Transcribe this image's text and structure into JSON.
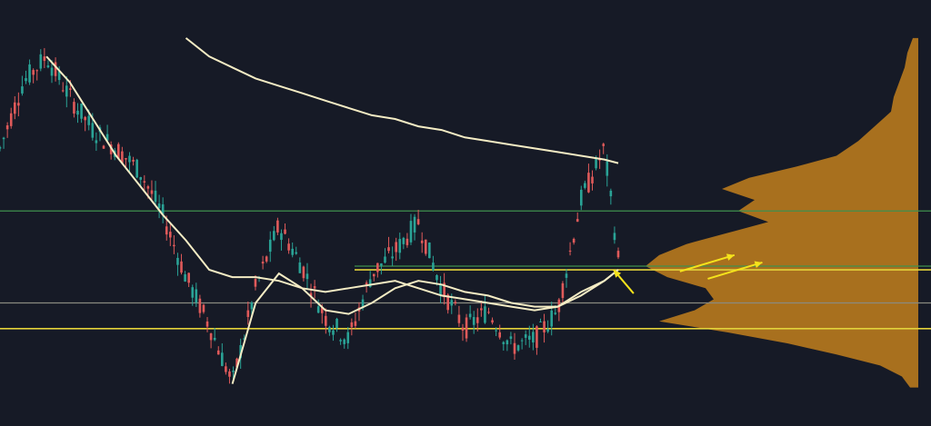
{
  "colors": {
    "background": "#161a26",
    "candle_up": "#2aa396",
    "candle_down": "#e05a5a",
    "moving_average": "#f4ecc4",
    "volume_profile": "#b87a1e",
    "level_green": "#3f8f4e",
    "level_yellow": "#e3d23a",
    "level_gray": "#8a8a80",
    "arrow": "#f5e31b"
  },
  "chart_data": {
    "type": "line",
    "title": "",
    "xlabel": "",
    "ylabel": "",
    "grid": false,
    "legend": "none",
    "ylim": [
      0,
      100
    ],
    "x": [
      0,
      5,
      10,
      15,
      20,
      25,
      30,
      35,
      40,
      45,
      50,
      55,
      60,
      65,
      70,
      75,
      80,
      85,
      90,
      95,
      100,
      105,
      110,
      115,
      120,
      125,
      130,
      133
    ],
    "series": [
      {
        "values": [
          72,
          90,
          97,
          86,
          77,
          72,
          66,
          54,
          37,
          24,
          8,
          34,
          51,
          40,
          26,
          20,
          38,
          44,
          52,
          34,
          23,
          28,
          18,
          20,
          28,
          58,
          72,
          42
        ]
      },
      {
        "values": [
          null,
          null,
          97,
          90,
          80,
          70,
          62,
          54,
          47,
          39,
          37,
          37,
          36,
          34,
          33,
          34,
          35,
          36,
          34,
          32,
          31,
          30,
          29,
          28,
          29,
          32,
          36,
          39
        ]
      },
      {
        "values": [
          null,
          null,
          null,
          null,
          null,
          null,
          null,
          null,
          null,
          null,
          8,
          30,
          38,
          34,
          28,
          27,
          30,
          34,
          36,
          35,
          33,
          32,
          30,
          29,
          29,
          33,
          36,
          39
        ]
      },
      {
        "values": [
          null,
          null,
          null,
          null,
          null,
          null,
          null,
          null,
          102,
          97,
          94,
          91,
          89,
          87,
          85,
          83,
          81,
          80,
          78,
          77,
          75,
          74,
          73,
          72,
          71,
          70,
          69,
          68
        ]
      }
    ],
    "levels": [
      {
        "value": 55,
        "color": "green"
      },
      {
        "value": 40,
        "color": "green"
      },
      {
        "value": 39,
        "color": "yellow"
      },
      {
        "value": 30,
        "color": "gray"
      },
      {
        "value": 23,
        "color": "yellow"
      }
    ],
    "volume_profile": {
      "anchor_side": "right",
      "values": [
        {
          "price": 102,
          "vol": 0.02
        },
        {
          "price": 98,
          "vol": 0.04
        },
        {
          "price": 94,
          "vol": 0.05
        },
        {
          "price": 90,
          "vol": 0.07
        },
        {
          "price": 86,
          "vol": 0.09
        },
        {
          "price": 82,
          "vol": 0.1
        },
        {
          "price": 78,
          "vol": 0.16
        },
        {
          "price": 74,
          "vol": 0.22
        },
        {
          "price": 70,
          "vol": 0.3
        },
        {
          "price": 67,
          "vol": 0.45
        },
        {
          "price": 64,
          "vol": 0.62
        },
        {
          "price": 61,
          "vol": 0.72
        },
        {
          "price": 58,
          "vol": 0.6
        },
        {
          "price": 55,
          "vol": 0.66
        },
        {
          "price": 52,
          "vol": 0.55
        },
        {
          "price": 49,
          "vol": 0.7
        },
        {
          "price": 46,
          "vol": 0.85
        },
        {
          "price": 43,
          "vol": 0.95
        },
        {
          "price": 40,
          "vol": 1.0
        },
        {
          "price": 37,
          "vol": 0.92
        },
        {
          "price": 34,
          "vol": 0.78
        },
        {
          "price": 31,
          "vol": 0.75
        },
        {
          "price": 28,
          "vol": 0.82
        },
        {
          "price": 25,
          "vol": 0.95
        },
        {
          "price": 22,
          "vol": 0.7
        },
        {
          "price": 19,
          "vol": 0.48
        },
        {
          "price": 16,
          "vol": 0.3
        },
        {
          "price": 13,
          "vol": 0.14
        },
        {
          "price": 10,
          "vol": 0.06
        },
        {
          "price": 7,
          "vol": 0.03
        }
      ]
    },
    "annotations": [
      {
        "type": "arrow",
        "direction": "up-left",
        "at_x": 132,
        "at_y": 39
      },
      {
        "type": "arrow",
        "direction": "up-right",
        "at_x": 158,
        "at_y": 43
      },
      {
        "type": "arrow",
        "direction": "up-right",
        "at_x": 164,
        "at_y": 41
      }
    ]
  }
}
